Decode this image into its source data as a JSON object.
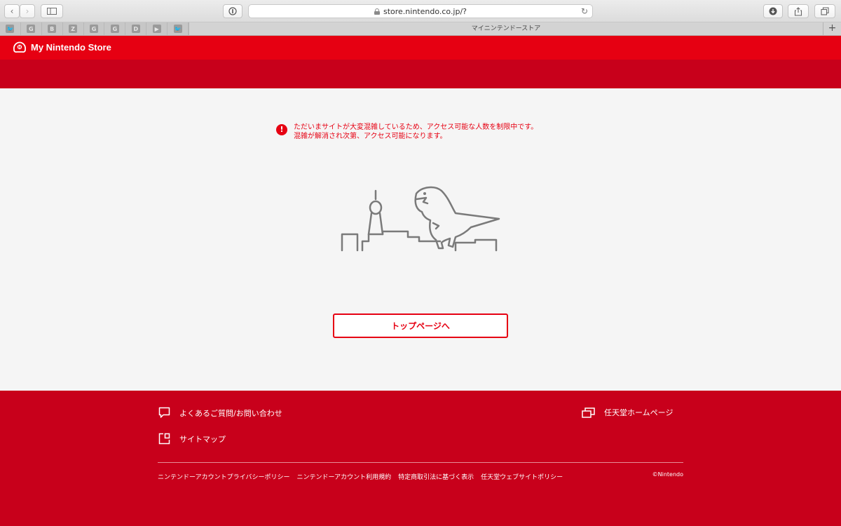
{
  "browser": {
    "url": "store.nintendo.co.jp/?",
    "tab_title": "マイニンテンドーストア",
    "bookmarks": [
      {
        "icon": "twitter-icon",
        "glyph": "🐦"
      },
      {
        "icon": "google-icon",
        "glyph": "G"
      },
      {
        "icon": "b-icon",
        "glyph": "B"
      },
      {
        "icon": "z-icon",
        "glyph": "Z"
      },
      {
        "icon": "google-icon",
        "glyph": "G"
      },
      {
        "icon": "g-icon",
        "glyph": "G"
      },
      {
        "icon": "d-icon",
        "glyph": "D"
      },
      {
        "icon": "youtube-icon",
        "glyph": "▶"
      },
      {
        "icon": "twitter-icon",
        "glyph": "🐦"
      }
    ]
  },
  "header": {
    "logo_text": "My Nintendo Store"
  },
  "notice": {
    "line1": "ただいまサイトが大変混雑しているため、アクセス可能な人数を制限中です。",
    "line2": "混雑が解消され次第、アクセス可能になります。"
  },
  "main": {
    "top_button_label": "トップページへ"
  },
  "footer": {
    "faq_label": "よくあるご質問/お問い合わせ",
    "sitemap_label": "サイトマップ",
    "nintendo_home_label": "任天堂ホームページ",
    "legal_links": [
      "ニンテンドーアカウントプライバシーポリシー",
      "ニンテンドーアカウント利用規約",
      "特定商取引法に基づく表示",
      "任天堂ウェブサイトポリシー"
    ],
    "copyright": "©Nintendo"
  },
  "colors": {
    "brand_red": "#e60012",
    "dark_red": "#c8001b",
    "background": "#f5f5f5"
  }
}
